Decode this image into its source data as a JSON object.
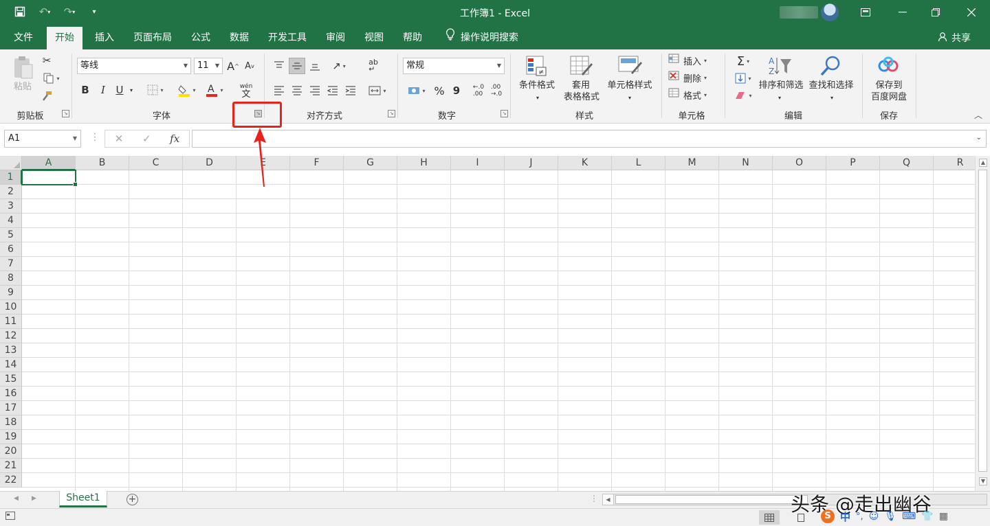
{
  "window": {
    "title": "工作簿1 - Excel",
    "brand_color": "#217346"
  },
  "quick_access": {
    "icons": [
      "save-icon",
      "undo-icon",
      "redo-icon",
      "customize-qat-icon"
    ]
  },
  "tabs": {
    "items": [
      "文件",
      "开始",
      "插入",
      "页面布局",
      "公式",
      "数据",
      "开发工具",
      "审阅",
      "视图",
      "帮助"
    ],
    "active": "开始",
    "tell_me": "操作说明搜索",
    "share": "共享"
  },
  "ribbon": {
    "clipboard": {
      "paste": "粘贴",
      "label": "剪贴板"
    },
    "font": {
      "font_name": "等线",
      "font_size": "11",
      "bold": "B",
      "italic": "I",
      "underline": "U",
      "label": "字体",
      "phonetic_top": "wén",
      "phonetic_bottom": "文"
    },
    "alignment": {
      "label": "对齐方式"
    },
    "number": {
      "format": "常规",
      "percent": "%",
      "comma": "9",
      "inc_decimal": "←.0\n.00",
      "dec_decimal": ".00\n→.0",
      "label": "数字"
    },
    "styles": {
      "conditional": "条件格式",
      "table_line1": "套用",
      "table_line2": "表格格式",
      "cell_styles": "单元格样式",
      "label": "样式"
    },
    "cells": {
      "insert": "插入",
      "delete": "删除",
      "format": "格式",
      "label": "单元格"
    },
    "editing": {
      "sort_filter": "排序和筛选",
      "find_select": "查找和选择",
      "label": "编辑"
    },
    "save": {
      "line1": "保存到",
      "line2": "百度网盘",
      "label": "保存"
    }
  },
  "formula_bar": {
    "name_box": "A1",
    "fx": "fx",
    "value": ""
  },
  "grid": {
    "columns": [
      "A",
      "B",
      "C",
      "D",
      "E",
      "F",
      "G",
      "H",
      "I",
      "J",
      "K",
      "L",
      "M",
      "N",
      "O",
      "P",
      "Q",
      "R"
    ],
    "rows": [
      "1",
      "2",
      "3",
      "4",
      "5",
      "6",
      "7",
      "8",
      "9",
      "10",
      "11",
      "12",
      "13",
      "14",
      "15",
      "16",
      "17",
      "18",
      "19",
      "20",
      "21",
      "22"
    ],
    "active_cell": "A1"
  },
  "sheets": {
    "tabs": [
      "Sheet1"
    ],
    "active": "Sheet1"
  },
  "annotation": {
    "color": "#e8231c",
    "target": "font-dialog-launcher"
  },
  "watermark": {
    "text": "头条 @走出幽谷",
    "ime_text": "中"
  }
}
